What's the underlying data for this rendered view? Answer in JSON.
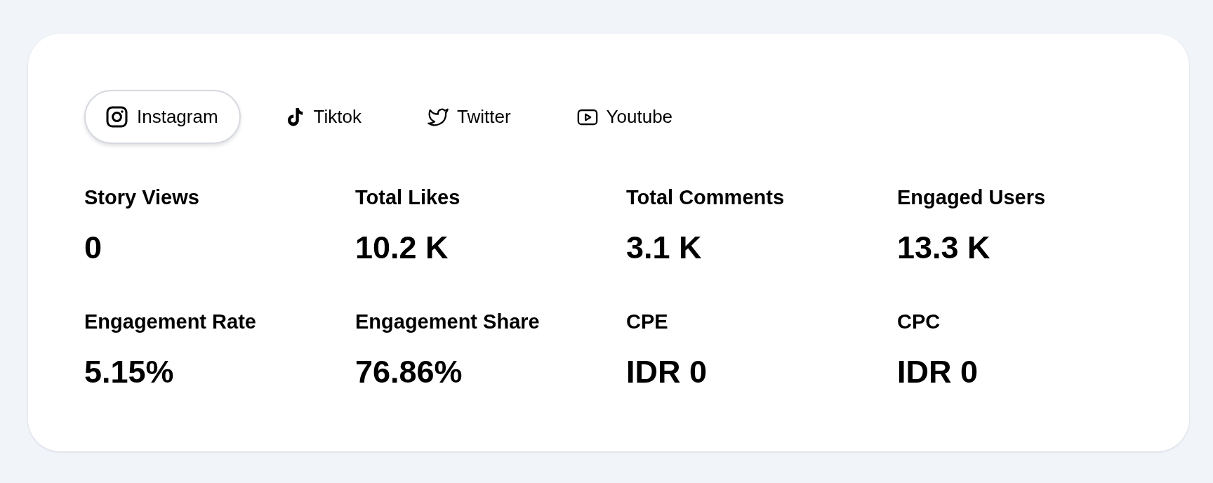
{
  "tabs": [
    {
      "label": "Instagram",
      "kind": "instagram",
      "selected": true
    },
    {
      "label": "Tiktok",
      "kind": "tiktok",
      "selected": false
    },
    {
      "label": "Twitter",
      "kind": "twitter",
      "selected": false
    },
    {
      "label": "Youtube",
      "kind": "youtube",
      "selected": false
    }
  ],
  "metrics": [
    {
      "label": "Story Views",
      "value": "0"
    },
    {
      "label": "Total Likes",
      "value": "10.2 K"
    },
    {
      "label": "Total Comments",
      "value": "3.1 K"
    },
    {
      "label": "Engaged Users",
      "value": "13.3 K"
    },
    {
      "label": "Engagement Rate",
      "value": "5.15%"
    },
    {
      "label": "Engagement Share",
      "value": "76.86%"
    },
    {
      "label": "CPE",
      "value": "IDR 0"
    },
    {
      "label": "CPC",
      "value": "IDR 0"
    }
  ]
}
